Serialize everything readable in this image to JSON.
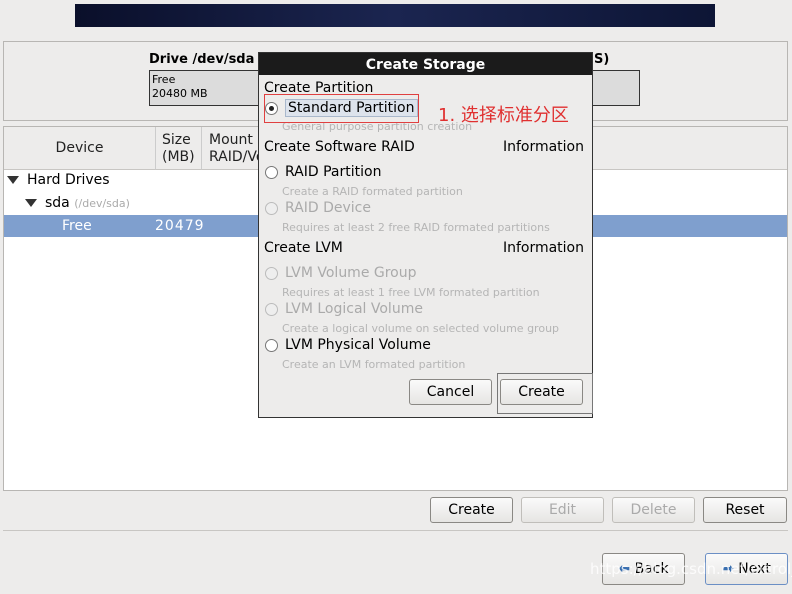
{
  "drive": {
    "title": "Drive /dev/sda (20480 MB) (Model: VMware, VMware Virtual S)",
    "bar_label": "Free",
    "bar_size": "20480 MB"
  },
  "table": {
    "headers": [
      "Device",
      "Size\n(MB)",
      "Mount Point/\nRAID/Volume"
    ],
    "rows": [
      {
        "label": "Hard Drives"
      },
      {
        "label": "sda",
        "sub": "(/dev/sda)"
      },
      {
        "label": "Free",
        "size": "20479",
        "selected": true
      }
    ]
  },
  "buttons": {
    "create": "Create",
    "edit": "Edit",
    "delete": "Delete",
    "reset": "Reset",
    "back": "Back",
    "next": "Next"
  },
  "dialog": {
    "title": "Create Storage",
    "sec_partition": "Create Partition",
    "standard": "Standard Partition",
    "standard_desc": "General purpose partition creation",
    "sec_raid": "Create Software RAID",
    "info1": "Information",
    "raid_part": "RAID Partition",
    "raid_part_desc": "Create a RAID formated partition",
    "raid_dev": "RAID Device",
    "raid_dev_desc": "Requires at least 2 free RAID formated partitions",
    "sec_lvm": "Create LVM",
    "info2": "Information",
    "lvm_vg": "LVM Volume Group",
    "lvm_vg_desc": "Requires at least 1 free LVM formated partition",
    "lvm_lv": "LVM Logical Volume",
    "lvm_lv_desc": "Create a logical volume on selected volume group",
    "lvm_pv": "LVM Physical Volume",
    "lvm_pv_desc": "Create an LVM formated partition",
    "cancel": "Cancel",
    "create": "Create",
    "selected_option": "Standard Partition"
  },
  "annotation": "1. 选择标准分区",
  "watermark": "https://blog.csdn.net/clarolja"
}
